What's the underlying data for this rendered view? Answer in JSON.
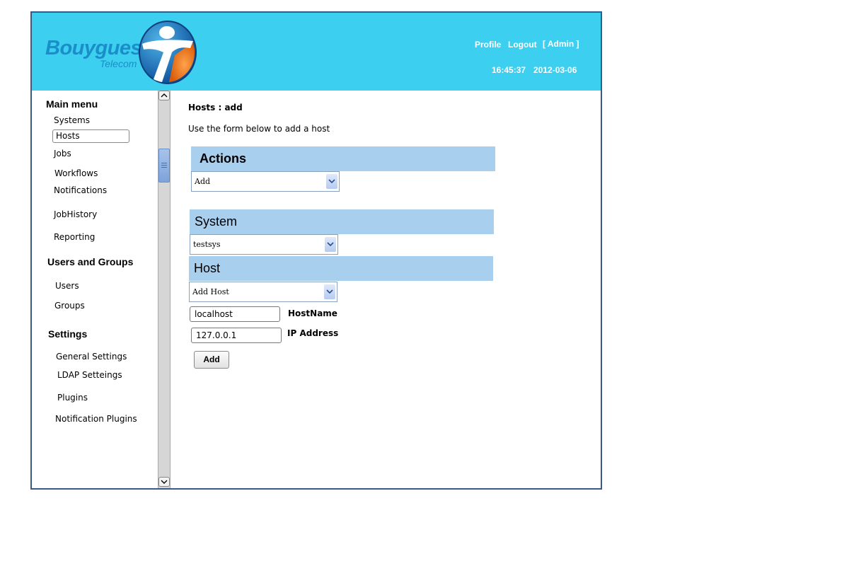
{
  "header": {
    "brand": "Bouygues",
    "brand_sub": "Telecom",
    "links": {
      "profile": "Profile",
      "logout": "Logout",
      "admin": "[ Admin ]"
    },
    "time": "16:45:37",
    "date": "2012-03-06"
  },
  "sidebar": {
    "main_menu": {
      "title": "Main menu",
      "items": [
        "Systems",
        "Hosts",
        "Jobs",
        "Workflows",
        "Notifications",
        "JobHistory",
        "Reporting"
      ],
      "selected": "Hosts"
    },
    "users_groups": {
      "title": "Users and Groups",
      "items": [
        "Users",
        "Groups"
      ]
    },
    "settings": {
      "title": "Settings",
      "items": [
        "General Settings",
        "LDAP Setteings",
        "Plugins",
        "Notification Plugins"
      ]
    }
  },
  "main": {
    "breadcrumb": "Hosts : add",
    "description": "Use the form below to add a host",
    "actions": {
      "title": "Actions",
      "selected": "Add"
    },
    "system": {
      "title": "System",
      "selected": "testsys"
    },
    "host": {
      "title": "Host",
      "selected": "Add Host"
    },
    "hostname": {
      "value": "localhost",
      "label": "HostName"
    },
    "ip": {
      "value": "127.0.0.1",
      "label": "IP Address"
    },
    "submit_label": "Add"
  },
  "colors": {
    "header_bg": "#3dcff0",
    "section_bg": "#a9cfee",
    "border": "#3a5a82",
    "brand_blue": "#1a8ec8",
    "brand_orange": "#f07b1c"
  }
}
